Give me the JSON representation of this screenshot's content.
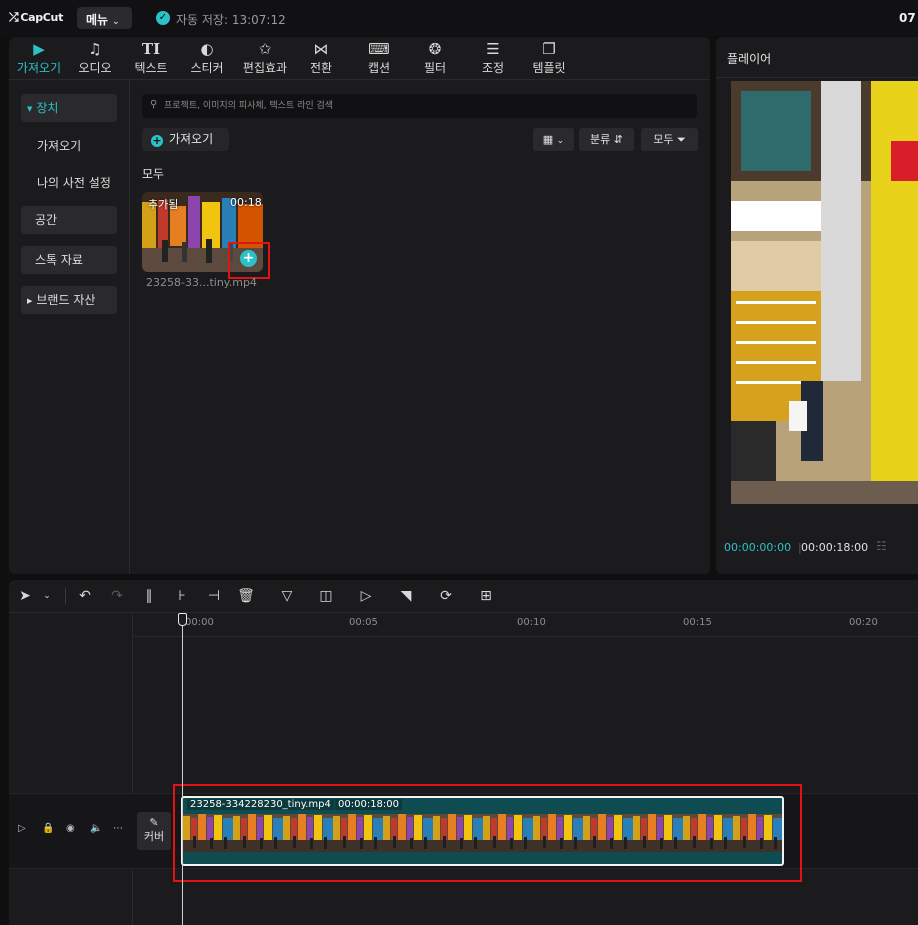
{
  "app": {
    "logo": "CapCut",
    "menu_label": "메뉴",
    "autosave_text": "자동 저장: 13:07:12",
    "clock_partial": "07"
  },
  "tabs": [
    {
      "label": "가져오기",
      "icon": "import-icon",
      "active": true
    },
    {
      "label": "오디오",
      "icon": "audio-icon"
    },
    {
      "label": "텍스트",
      "icon": "text-icon"
    },
    {
      "label": "스티커",
      "icon": "sticker-icon"
    },
    {
      "label": "편집효과",
      "icon": "effects-icon"
    },
    {
      "label": "전환",
      "icon": "transition-icon"
    },
    {
      "label": "캡션",
      "icon": "caption-icon"
    },
    {
      "label": "필터",
      "icon": "filter-icon"
    },
    {
      "label": "조정",
      "icon": "adjust-icon"
    },
    {
      "label": "템플릿",
      "icon": "template-icon"
    }
  ],
  "sidebar": {
    "device": "장치",
    "import": "가져오기",
    "presets": "나의 사전 설정",
    "space": "공간",
    "stock": "스톡 자료",
    "brand": "브랜드 자산"
  },
  "search": {
    "placeholder": "프로젝트, 이미지의 피사체, 텍스트 라인 검색"
  },
  "toolbar": {
    "import_label": "가져오기",
    "sort_label": "분류",
    "filter_label": "모두"
  },
  "library": {
    "section_title": "모두",
    "item": {
      "added_label": "추가됨",
      "duration": "00:18",
      "filename": "23258-33...tiny.mp4"
    }
  },
  "player": {
    "title": "플레이어",
    "current_time": "00:00:00:00",
    "total_time": "00:00:18:00"
  },
  "timeline": {
    "ruler": [
      "00:00",
      "00:05",
      "00:10",
      "00:15",
      "00:20"
    ],
    "cover_label": "커버",
    "clip_name": "23258-334228230_tiny.mp4",
    "clip_duration": "00:00:18:00"
  },
  "colors": {
    "accent": "#2cc1c9",
    "highlight": "#e01414",
    "clip": "#0f4c51"
  }
}
